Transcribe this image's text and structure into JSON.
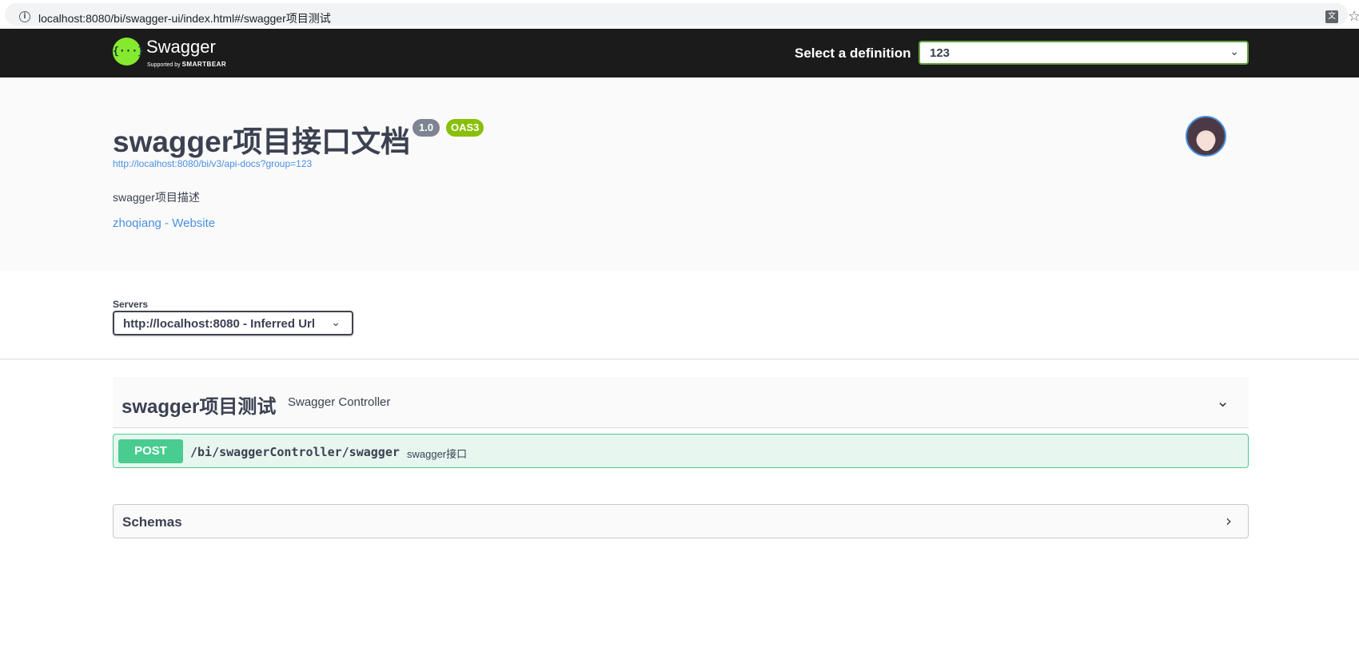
{
  "browser": {
    "url": "localhost:8080/bi/swagger-ui/index.html#/swagger项目测试",
    "info_glyph": "i",
    "translate_glyph": "文",
    "star_glyph": "☆"
  },
  "topbar": {
    "logo_glyph": "{···}",
    "logo_name": "Swagger",
    "logo_sub_prefix": "Supported by ",
    "logo_sub_brand": "SMARTBEAR",
    "definition_label": "Select a definition",
    "definition_value": "123",
    "chevron": "⌄"
  },
  "info": {
    "title": "swagger项目接口文档",
    "version": "1.0",
    "oas": "OAS3",
    "api_url": "http://localhost:8080/bi/v3/api-docs?group=123",
    "description": "swagger项目描述",
    "contact": "zhoqiang - Website"
  },
  "servers": {
    "label": "Servers",
    "value": "http://localhost:8080 - Inferred Url",
    "chevron": "⌄"
  },
  "tag": {
    "name": "swagger项目测试",
    "description": "Swagger Controller",
    "chevron": "⌄"
  },
  "operation": {
    "method": "POST",
    "path": "/bi/swaggerController/swagger",
    "summary": "swagger接口"
  },
  "schemas": {
    "title": "Schemas",
    "chevron": "›"
  },
  "colors": {
    "topbar_bg": "#1b1b1b",
    "logo_green": "#85ea2d",
    "definition_border": "#62a03f",
    "link_blue": "#4990e2",
    "version_badge": "#7d8492",
    "oas_badge": "#89bf04",
    "post_green": "#49cc90",
    "post_bg": "#e8f6f0"
  },
  "icons": {
    "info": "info-icon",
    "translate": "translate-icon",
    "bookmark": "star-icon",
    "definition_dropdown": "chevron-down-icon",
    "servers_dropdown": "chevron-down-icon",
    "tag_toggle": "chevron-down-icon",
    "schemas_toggle": "chevron-right-icon"
  }
}
